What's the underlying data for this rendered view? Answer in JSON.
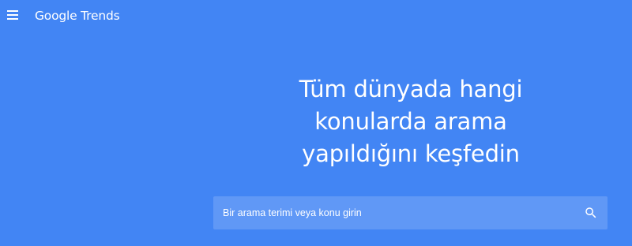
{
  "header": {
    "menu_icon": "hamburger-menu-icon",
    "logo_text": "Google Trends"
  },
  "hero": {
    "headline_lines": [
      "Tüm dünyada hangi",
      "konularda arama",
      "yapıldığını keşfedin"
    ]
  },
  "search": {
    "placeholder": "Bir arama terimi veya konu girin",
    "value": "",
    "icon": "search-icon"
  },
  "colors": {
    "background": "#4285f4",
    "search_box": "#6098f6",
    "text": "#ffffff"
  }
}
